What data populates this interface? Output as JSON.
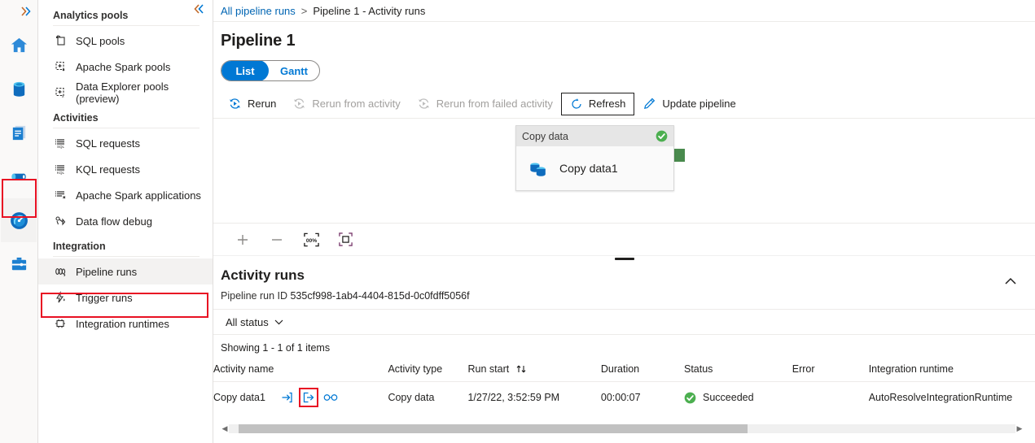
{
  "rail": {
    "expand_icon": "chevron-double-right-icon",
    "items": [
      {
        "name": "home",
        "icon": "home-icon",
        "selected": false
      },
      {
        "name": "data",
        "icon": "database-icon",
        "selected": false
      },
      {
        "name": "develop",
        "icon": "document-icon",
        "selected": false
      },
      {
        "name": "integrate",
        "icon": "pipeline-icon",
        "selected": false
      },
      {
        "name": "monitor",
        "icon": "gauge-icon",
        "selected": true
      },
      {
        "name": "manage",
        "icon": "toolbox-icon",
        "selected": false
      }
    ]
  },
  "nav": {
    "collapse_icon": "chevron-double-left-icon",
    "groups": [
      {
        "title": "Analytics pools",
        "items": [
          {
            "label": "SQL pools",
            "icon": "sql-pool-icon"
          },
          {
            "label": "Apache Spark pools",
            "icon": "spark-pool-icon"
          },
          {
            "label": "Data Explorer pools (preview)",
            "icon": "data-explorer-pool-icon"
          }
        ]
      },
      {
        "title": "Activities",
        "items": [
          {
            "label": "SQL requests",
            "icon": "sql-request-icon"
          },
          {
            "label": "KQL requests",
            "icon": "kql-request-icon"
          },
          {
            "label": "Apache Spark applications",
            "icon": "spark-application-icon"
          },
          {
            "label": "Data flow debug",
            "icon": "data-flow-debug-icon"
          }
        ]
      },
      {
        "title": "Integration",
        "items": [
          {
            "label": "Pipeline runs",
            "icon": "pipeline-runs-icon",
            "active": true
          },
          {
            "label": "Trigger runs",
            "icon": "trigger-runs-icon"
          },
          {
            "label": "Integration runtimes",
            "icon": "integration-runtimes-icon"
          }
        ]
      }
    ]
  },
  "breadcrumb": {
    "root": "All pipeline runs",
    "separator": ">",
    "current": "Pipeline 1 - Activity runs"
  },
  "page": {
    "title": "Pipeline 1"
  },
  "pivot": {
    "list": "List",
    "gantt": "Gantt",
    "selected": "List"
  },
  "toolbar": {
    "rerun": "Rerun",
    "rerun_from_activity": "Rerun from activity",
    "rerun_from_failed": "Rerun from failed activity",
    "refresh": "Refresh",
    "update_pipeline": "Update pipeline"
  },
  "canvas": {
    "node": {
      "type": "Copy data",
      "label": "Copy data1",
      "status_icon": "success-check-icon",
      "status_color": "#4caf50",
      "port_color": "#498a4d"
    },
    "tools": {
      "zoom_in": "zoom-in-icon",
      "zoom_out": "zoom-out-icon",
      "zoom_level": "zoom-to-100-icon",
      "fit_to_screen": "fit-to-screen-icon"
    }
  },
  "activity_runs": {
    "title": "Activity runs",
    "collapse_icon": "chevron-up-icon",
    "run_id_label": "Pipeline run ID",
    "run_id_value": "535cf998-1ab4-4404-815d-0c0fdff5056f",
    "status_filter": "All status",
    "status_filter_icon": "chevron-down-icon",
    "showing": "Showing 1 - 1 of 1 items",
    "columns": [
      "Activity name",
      "Activity type",
      "Run start",
      "Duration",
      "Status",
      "Error",
      "Integration runtime"
    ],
    "sort_column": "Run start",
    "sort_icon": "sort-updown-icon",
    "rows": [
      {
        "activity_name": "Copy data1",
        "actions": [
          {
            "name": "input-icon",
            "highlighted": false
          },
          {
            "name": "output-icon",
            "highlighted": true
          },
          {
            "name": "details-glasses-icon",
            "highlighted": false
          }
        ],
        "activity_type": "Copy data",
        "run_start": "1/27/22, 3:52:59 PM",
        "duration": "00:00:07",
        "status": "Succeeded",
        "status_icon": "success-check-icon",
        "error": "",
        "integration_runtime": "AutoResolveIntegrationRuntime"
      }
    ]
  },
  "scrollbar": {
    "left_arrow": "scroll-left-icon",
    "right_arrow": "scroll-right-icon"
  },
  "colors": {
    "accent": "#0078d4",
    "highlight_box": "#e81123",
    "success": "#4caf50",
    "link": "#0065b3"
  }
}
